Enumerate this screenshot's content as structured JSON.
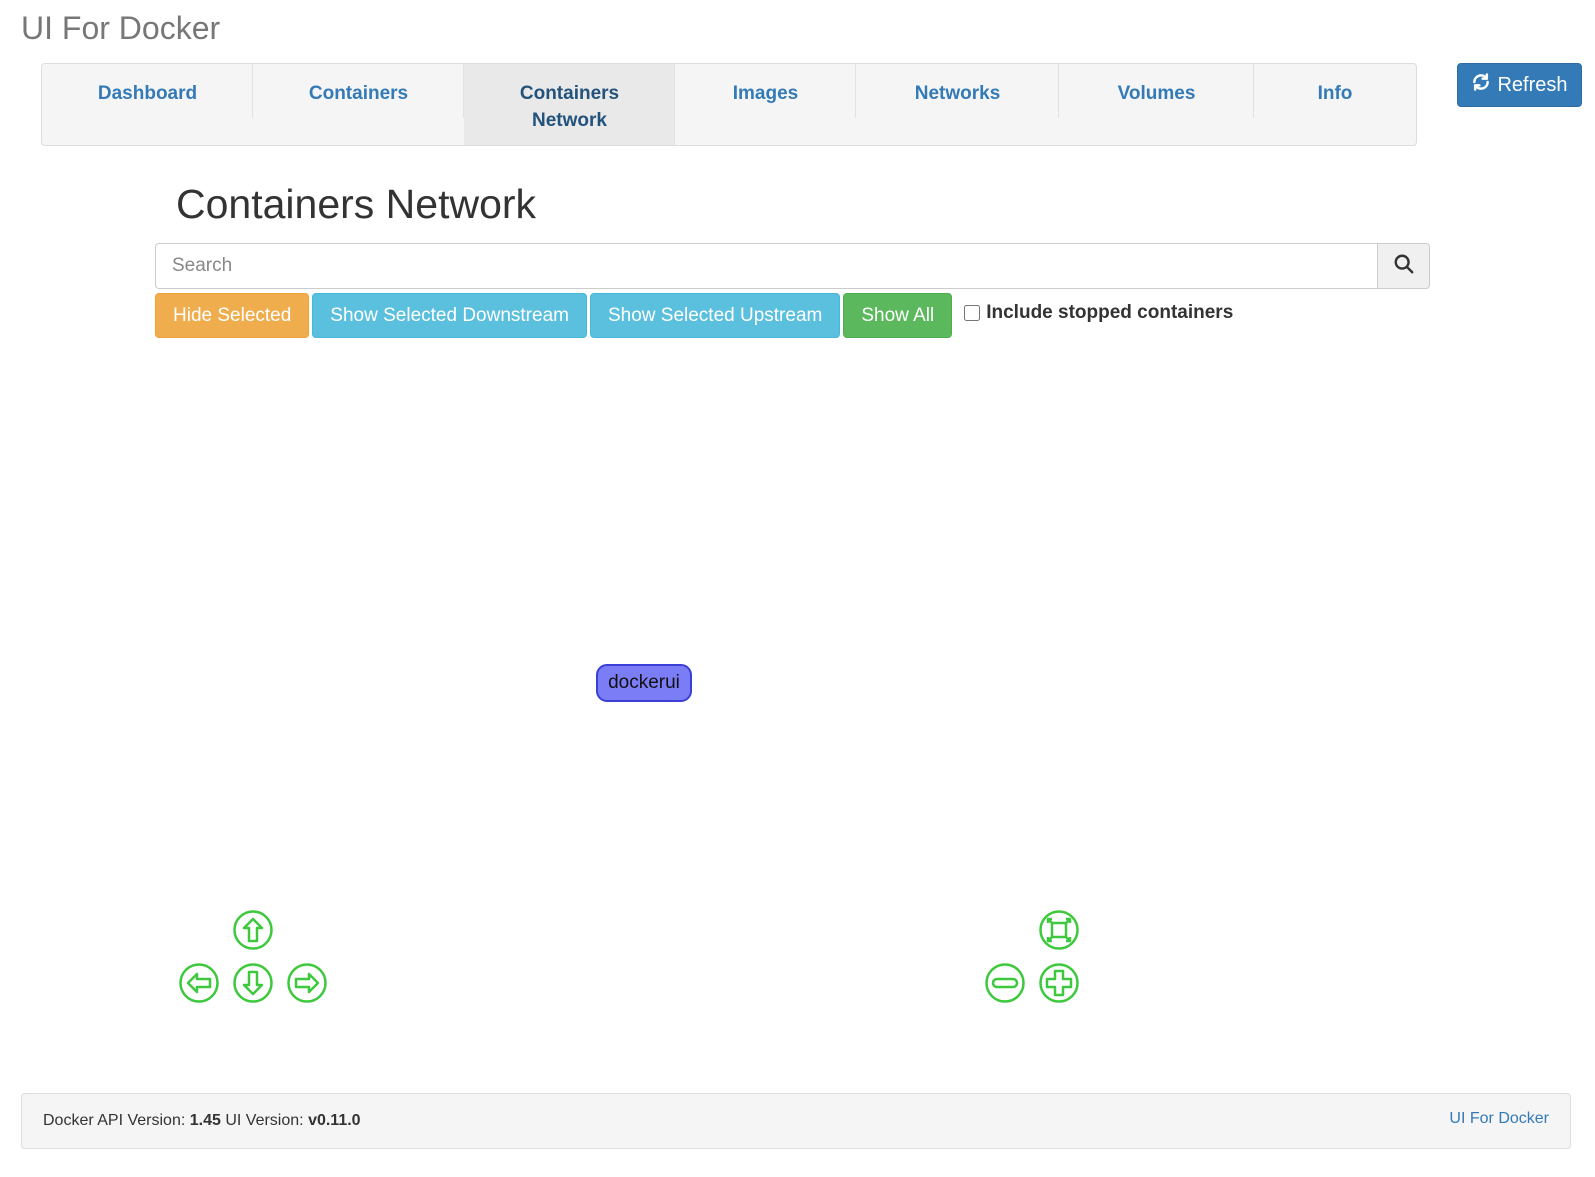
{
  "app": {
    "brand": "UI For Docker"
  },
  "nav": {
    "tabs": [
      {
        "label": "Dashboard"
      },
      {
        "label": "Containers"
      },
      {
        "label": "Containers Network"
      },
      {
        "label": "Images"
      },
      {
        "label": "Networks"
      },
      {
        "label": "Volumes"
      },
      {
        "label": "Info"
      }
    ],
    "refresh_label": "Refresh"
  },
  "page": {
    "title": "Containers Network"
  },
  "search": {
    "placeholder": "Search",
    "value": ""
  },
  "actions": {
    "hide_selected": "Hide Selected",
    "show_downstream": "Show Selected Downstream",
    "show_upstream": "Show Selected Upstream",
    "show_all": "Show All",
    "include_stopped": "Include stopped containers",
    "include_stopped_checked": false
  },
  "graph": {
    "nodes": [
      {
        "label": "dockerui",
        "color": "#7b7df7"
      }
    ],
    "controls": [
      "arrow-up-icon",
      "arrow-left-icon",
      "arrow-down-icon",
      "arrow-right-icon",
      "zoom-extends-icon",
      "zoom-out-icon",
      "zoom-in-icon"
    ],
    "control_color": "#3dc83d"
  },
  "footer": {
    "api_label": "Docker API Version:",
    "api_version": "1.45",
    "ui_label": "UI Version:",
    "ui_version": "v0.11.0",
    "link": "UI For Docker"
  }
}
